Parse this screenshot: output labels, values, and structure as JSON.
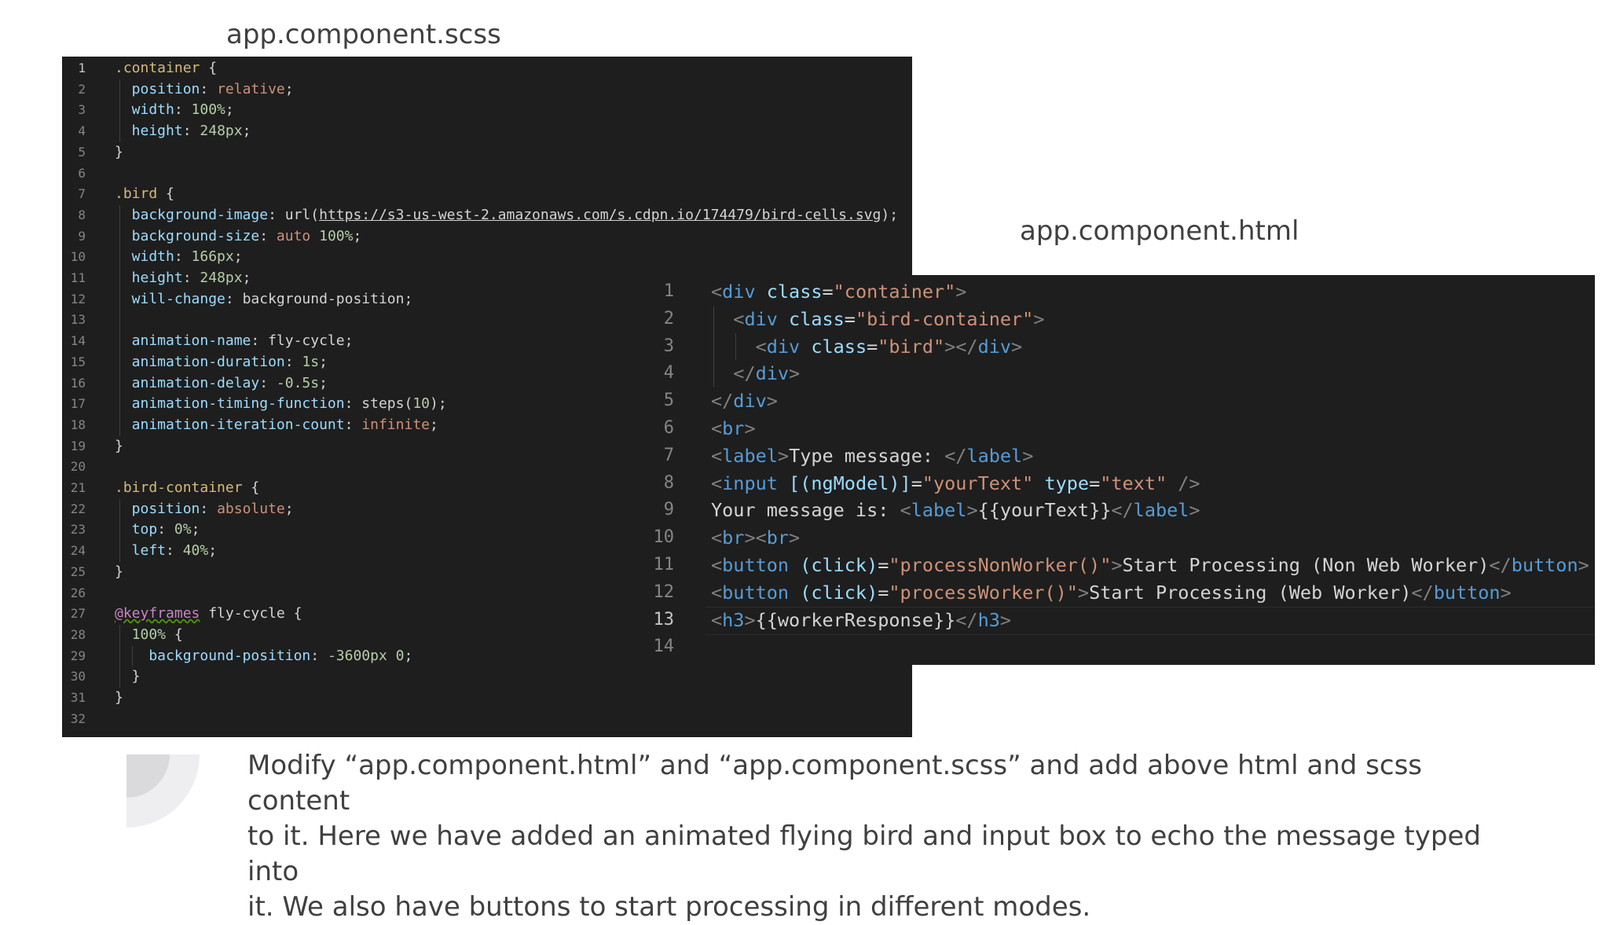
{
  "captions": {
    "scss_file": "app.component.scss",
    "html_file": "app.component.html"
  },
  "scss_code": {
    "lines": [
      {
        "n": "1",
        "tokens": [
          {
            "t": ".container",
            "c": "sel"
          },
          {
            "t": " {",
            "c": "txt"
          }
        ]
      },
      {
        "n": "2",
        "tokens": [
          {
            "t": "  position",
            "c": "prop"
          },
          {
            "t": ": ",
            "c": "txt"
          },
          {
            "t": "relative",
            "c": "kw"
          },
          {
            "t": ";",
            "c": "txt"
          }
        ]
      },
      {
        "n": "3",
        "tokens": [
          {
            "t": "  width",
            "c": "prop"
          },
          {
            "t": ": ",
            "c": "txt"
          },
          {
            "t": "100%",
            "c": "num"
          },
          {
            "t": ";",
            "c": "txt"
          }
        ]
      },
      {
        "n": "4",
        "tokens": [
          {
            "t": "  height",
            "c": "prop"
          },
          {
            "t": ": ",
            "c": "txt"
          },
          {
            "t": "248px",
            "c": "num"
          },
          {
            "t": ";",
            "c": "txt"
          }
        ]
      },
      {
        "n": "5",
        "tokens": [
          {
            "t": "}",
            "c": "txt"
          }
        ]
      },
      {
        "n": "6",
        "tokens": []
      },
      {
        "n": "7",
        "tokens": [
          {
            "t": ".bird",
            "c": "sel"
          },
          {
            "t": " {",
            "c": "txt"
          }
        ]
      },
      {
        "n": "8",
        "tokens": [
          {
            "t": "  background-image",
            "c": "prop"
          },
          {
            "t": ": url(",
            "c": "txt"
          },
          {
            "t": "https://s3-us-west-2.amazonaws.com/s.cdpn.io/174479/bird-cells.svg",
            "c": "url"
          },
          {
            "t": ");",
            "c": "txt"
          }
        ]
      },
      {
        "n": "9",
        "tokens": [
          {
            "t": "  background-size",
            "c": "prop"
          },
          {
            "t": ": ",
            "c": "txt"
          },
          {
            "t": "auto",
            "c": "kw"
          },
          {
            "t": " ",
            "c": "txt"
          },
          {
            "t": "100%",
            "c": "num"
          },
          {
            "t": ";",
            "c": "txt"
          }
        ]
      },
      {
        "n": "10",
        "tokens": [
          {
            "t": "  width",
            "c": "prop"
          },
          {
            "t": ": ",
            "c": "txt"
          },
          {
            "t": "166px",
            "c": "num"
          },
          {
            "t": ";",
            "c": "txt"
          }
        ]
      },
      {
        "n": "11",
        "tokens": [
          {
            "t": "  height",
            "c": "prop"
          },
          {
            "t": ": ",
            "c": "txt"
          },
          {
            "t": "248px",
            "c": "num"
          },
          {
            "t": ";",
            "c": "txt"
          }
        ]
      },
      {
        "n": "12",
        "tokens": [
          {
            "t": "  will-change",
            "c": "prop"
          },
          {
            "t": ": background-position;",
            "c": "txt"
          }
        ]
      },
      {
        "n": "13",
        "tokens": []
      },
      {
        "n": "14",
        "tokens": [
          {
            "t": "  animation-name",
            "c": "prop"
          },
          {
            "t": ": fly-cycle;",
            "c": "txt"
          }
        ]
      },
      {
        "n": "15",
        "tokens": [
          {
            "t": "  animation-duration",
            "c": "prop"
          },
          {
            "t": ": ",
            "c": "txt"
          },
          {
            "t": "1s",
            "c": "num"
          },
          {
            "t": ";",
            "c": "txt"
          }
        ]
      },
      {
        "n": "16",
        "tokens": [
          {
            "t": "  animation-delay",
            "c": "prop"
          },
          {
            "t": ": ",
            "c": "txt"
          },
          {
            "t": "-0.5s",
            "c": "num"
          },
          {
            "t": ";",
            "c": "txt"
          }
        ]
      },
      {
        "n": "17",
        "tokens": [
          {
            "t": "  animation-timing-function",
            "c": "prop"
          },
          {
            "t": ": steps(",
            "c": "txt"
          },
          {
            "t": "10",
            "c": "num"
          },
          {
            "t": ");",
            "c": "txt"
          }
        ]
      },
      {
        "n": "18",
        "tokens": [
          {
            "t": "  animation-iteration-count",
            "c": "prop"
          },
          {
            "t": ": ",
            "c": "txt"
          },
          {
            "t": "infinite",
            "c": "kw"
          },
          {
            "t": ";",
            "c": "txt"
          }
        ]
      },
      {
        "n": "19",
        "tokens": [
          {
            "t": "}",
            "c": "txt"
          }
        ]
      },
      {
        "n": "20",
        "tokens": []
      },
      {
        "n": "21",
        "tokens": [
          {
            "t": ".bird-container",
            "c": "sel"
          },
          {
            "t": " {",
            "c": "txt"
          }
        ]
      },
      {
        "n": "22",
        "tokens": [
          {
            "t": "  position",
            "c": "prop"
          },
          {
            "t": ": ",
            "c": "txt"
          },
          {
            "t": "absolute",
            "c": "kw"
          },
          {
            "t": ";",
            "c": "txt"
          }
        ]
      },
      {
        "n": "23",
        "tokens": [
          {
            "t": "  top",
            "c": "prop"
          },
          {
            "t": ": ",
            "c": "txt"
          },
          {
            "t": "0%",
            "c": "num"
          },
          {
            "t": ";",
            "c": "txt"
          }
        ]
      },
      {
        "n": "24",
        "tokens": [
          {
            "t": "  left",
            "c": "prop"
          },
          {
            "t": ": ",
            "c": "txt"
          },
          {
            "t": "40%",
            "c": "num"
          },
          {
            "t": ";",
            "c": "txt"
          }
        ]
      },
      {
        "n": "25",
        "tokens": [
          {
            "t": "}",
            "c": "txt"
          }
        ]
      },
      {
        "n": "26",
        "tokens": []
      },
      {
        "n": "27",
        "tokens": [
          {
            "t": "@keyframes",
            "c": "at"
          },
          {
            "t": " fly-cycle {",
            "c": "txt"
          }
        ]
      },
      {
        "n": "28",
        "tokens": [
          {
            "t": "  100%",
            "c": "num"
          },
          {
            "t": " {",
            "c": "txt"
          }
        ]
      },
      {
        "n": "29",
        "tokens": [
          {
            "t": "    background-position",
            "c": "prop"
          },
          {
            "t": ": ",
            "c": "txt"
          },
          {
            "t": "-3600px 0",
            "c": "num"
          },
          {
            "t": ";",
            "c": "txt"
          }
        ]
      },
      {
        "n": "30",
        "tokens": [
          {
            "t": "  }",
            "c": "txt"
          }
        ]
      },
      {
        "n": "31",
        "tokens": [
          {
            "t": "}",
            "c": "txt"
          }
        ]
      },
      {
        "n": "32",
        "tokens": []
      }
    ]
  },
  "html_code": {
    "current_line": "13",
    "lines": [
      {
        "n": "1",
        "tokens": [
          {
            "t": "<",
            "c": "punct"
          },
          {
            "t": "div",
            "c": "tag"
          },
          {
            "t": " class",
            "c": "attr"
          },
          {
            "t": "=",
            "c": "txt"
          },
          {
            "t": "\"container\"",
            "c": "str"
          },
          {
            "t": ">",
            "c": "punct"
          }
        ]
      },
      {
        "n": "2",
        "tokens": [
          {
            "t": "  <",
            "c": "punct"
          },
          {
            "t": "div",
            "c": "tag"
          },
          {
            "t": " class",
            "c": "attr"
          },
          {
            "t": "=",
            "c": "txt"
          },
          {
            "t": "\"bird-container\"",
            "c": "str"
          },
          {
            "t": ">",
            "c": "punct"
          }
        ]
      },
      {
        "n": "3",
        "tokens": [
          {
            "t": "    <",
            "c": "punct"
          },
          {
            "t": "div",
            "c": "tag"
          },
          {
            "t": " class",
            "c": "attr"
          },
          {
            "t": "=",
            "c": "txt"
          },
          {
            "t": "\"bird\"",
            "c": "str"
          },
          {
            "t": "></",
            "c": "punct"
          },
          {
            "t": "div",
            "c": "tag"
          },
          {
            "t": ">",
            "c": "punct"
          }
        ]
      },
      {
        "n": "4",
        "tokens": [
          {
            "t": "  </",
            "c": "punct"
          },
          {
            "t": "div",
            "c": "tag"
          },
          {
            "t": ">",
            "c": "punct"
          }
        ]
      },
      {
        "n": "5",
        "tokens": [
          {
            "t": "</",
            "c": "punct"
          },
          {
            "t": "div",
            "c": "tag"
          },
          {
            "t": ">",
            "c": "punct"
          }
        ]
      },
      {
        "n": "6",
        "tokens": [
          {
            "t": "<",
            "c": "punct"
          },
          {
            "t": "br",
            "c": "tag"
          },
          {
            "t": ">",
            "c": "punct"
          }
        ]
      },
      {
        "n": "7",
        "tokens": [
          {
            "t": "<",
            "c": "punct"
          },
          {
            "t": "label",
            "c": "tag"
          },
          {
            "t": ">",
            "c": "punct"
          },
          {
            "t": "Type message: ",
            "c": "txt"
          },
          {
            "t": "</",
            "c": "punct"
          },
          {
            "t": "label",
            "c": "tag"
          },
          {
            "t": ">",
            "c": "punct"
          }
        ]
      },
      {
        "n": "8",
        "tokens": [
          {
            "t": "<",
            "c": "punct"
          },
          {
            "t": "input",
            "c": "tag"
          },
          {
            "t": " [(ngModel)]",
            "c": "attr"
          },
          {
            "t": "=",
            "c": "txt"
          },
          {
            "t": "\"yourText\"",
            "c": "str"
          },
          {
            "t": " type",
            "c": "attr"
          },
          {
            "t": "=",
            "c": "txt"
          },
          {
            "t": "\"text\"",
            "c": "str"
          },
          {
            "t": " />",
            "c": "punct"
          }
        ]
      },
      {
        "n": "9",
        "tokens": [
          {
            "t": "Your message is: ",
            "c": "txt"
          },
          {
            "t": "<",
            "c": "punct"
          },
          {
            "t": "label",
            "c": "tag"
          },
          {
            "t": ">",
            "c": "punct"
          },
          {
            "t": "{{yourText}}",
            "c": "txt"
          },
          {
            "t": "</",
            "c": "punct"
          },
          {
            "t": "label",
            "c": "tag"
          },
          {
            "t": ">",
            "c": "punct"
          }
        ]
      },
      {
        "n": "10",
        "tokens": [
          {
            "t": "<",
            "c": "punct"
          },
          {
            "t": "br",
            "c": "tag"
          },
          {
            "t": "><",
            "c": "punct"
          },
          {
            "t": "br",
            "c": "tag"
          },
          {
            "t": ">",
            "c": "punct"
          }
        ]
      },
      {
        "n": "11",
        "tokens": [
          {
            "t": "<",
            "c": "punct"
          },
          {
            "t": "button",
            "c": "tag"
          },
          {
            "t": " (click)",
            "c": "attr"
          },
          {
            "t": "=",
            "c": "txt"
          },
          {
            "t": "\"processNonWorker()\"",
            "c": "str"
          },
          {
            "t": ">",
            "c": "punct"
          },
          {
            "t": "Start Processing (Non Web Worker)",
            "c": "txt"
          },
          {
            "t": "</",
            "c": "punct"
          },
          {
            "t": "button",
            "c": "tag"
          },
          {
            "t": ">",
            "c": "punct"
          }
        ]
      },
      {
        "n": "12",
        "tokens": [
          {
            "t": "<",
            "c": "punct"
          },
          {
            "t": "button",
            "c": "tag"
          },
          {
            "t": " (click)",
            "c": "attr"
          },
          {
            "t": "=",
            "c": "txt"
          },
          {
            "t": "\"processWorker()\"",
            "c": "str"
          },
          {
            "t": ">",
            "c": "punct"
          },
          {
            "t": "Start Processing (Web Worker)",
            "c": "txt"
          },
          {
            "t": "</",
            "c": "punct"
          },
          {
            "t": "button",
            "c": "tag"
          },
          {
            "t": ">",
            "c": "punct"
          }
        ]
      },
      {
        "n": "13",
        "tokens": [
          {
            "t": "<",
            "c": "punct"
          },
          {
            "t": "h3",
            "c": "tag"
          },
          {
            "t": ">",
            "c": "punct"
          },
          {
            "t": "{{workerResponse}}",
            "c": "txt"
          },
          {
            "t": "</",
            "c": "punct"
          },
          {
            "t": "h3",
            "c": "tag"
          },
          {
            "t": ">",
            "c": "punct"
          }
        ]
      },
      {
        "n": "14",
        "tokens": []
      }
    ]
  },
  "description": "Modify “app.component.html” and “app.component.scss” and add above html and scss content\nto it. Here we have added an animated flying bird and input box to echo the message typed into\nit. We also have buttons to start processing in different modes."
}
